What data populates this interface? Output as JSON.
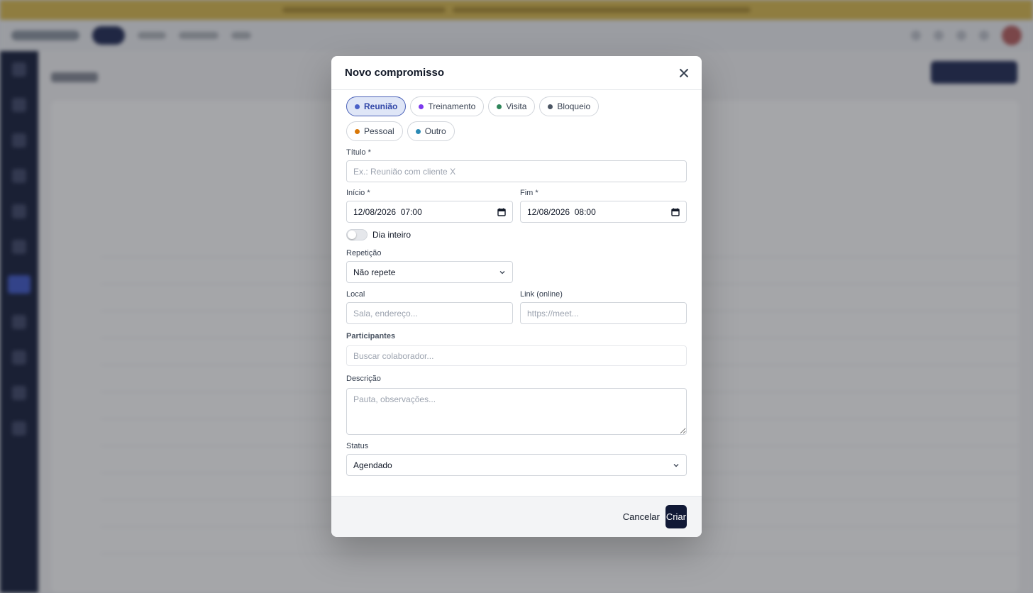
{
  "colors": {
    "accent": "#3147a8",
    "primary_button": "#111936",
    "chip_active_bg": "#dfe6f7"
  },
  "modal": {
    "title": "Novo compromisso",
    "close_icon": "close-icon",
    "types": [
      {
        "label": "Reunião",
        "color": "#4a61c8",
        "active": true
      },
      {
        "label": "Treinamento",
        "color": "#7c3aed",
        "active": false
      },
      {
        "label": "Visita",
        "color": "#2f855a",
        "active": false
      },
      {
        "label": "Bloqueio",
        "color": "#4b5563",
        "active": false
      },
      {
        "label": "Pessoal",
        "color": "#d97706",
        "active": false
      },
      {
        "label": "Outro",
        "color": "#2b8ab5",
        "active": false
      }
    ],
    "title_field": {
      "label": "Título *",
      "placeholder": "Ex.: Reunião com cliente X"
    },
    "start": {
      "label": "Início *",
      "value": "12/08/2026  07:00"
    },
    "end": {
      "label": "Fim *",
      "value": "12/08/2026  08:00"
    },
    "all_day": {
      "label": "Dia inteiro",
      "checked": false
    },
    "repeat": {
      "label": "Repetição",
      "value": "Não repete"
    },
    "location": {
      "label": "Local",
      "placeholder": "Sala, endereço..."
    },
    "link": {
      "label": "Link (online)",
      "placeholder": "https://meet..."
    },
    "participants": {
      "label": "Participantes",
      "placeholder": "Buscar colaborador..."
    },
    "description": {
      "label": "Descrição",
      "placeholder": "Pauta, observações..."
    },
    "status": {
      "label": "Status",
      "value": "Agendado"
    },
    "footer": {
      "cancel": "Cancelar",
      "create": "Criar"
    }
  }
}
